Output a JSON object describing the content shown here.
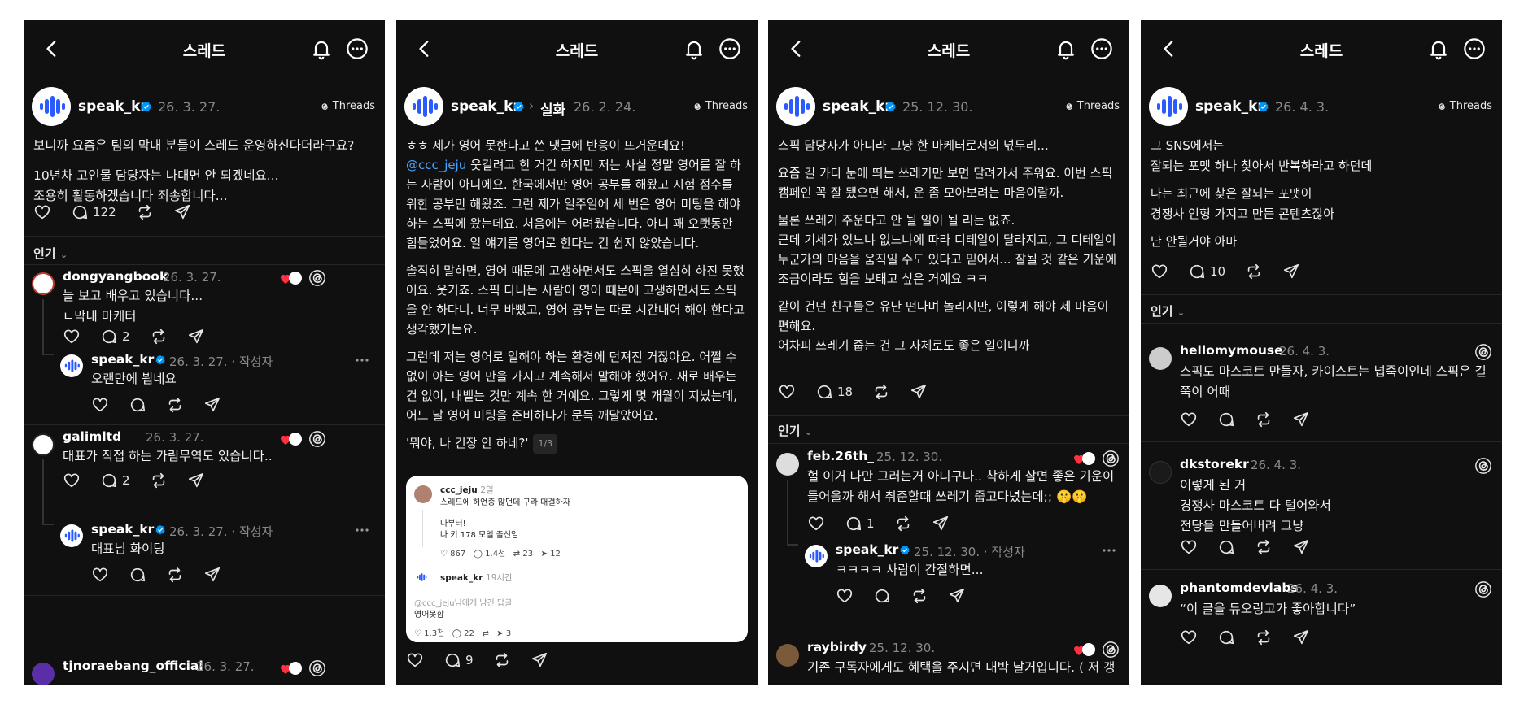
{
  "panels": [
    {
      "header_title": "스레드",
      "post": {
        "username": "speak_kr",
        "date": "26. 3. 27.",
        "badge": "Threads",
        "paragraphs": [
          "보니까 요즘은 팀의 막내 분들이 스레드 운영하신다더라구요?",
          "10년차 고인물 담당자는 나대면 안 되겠네요...",
          "조용히 활동하겠습니다 죄송합니다..."
        ],
        "reply_count": "122"
      },
      "sort_label": "인기",
      "comments": [
        {
          "username": "dongyangbook",
          "date": "26. 3. 27.",
          "text_lines": [
            "늘 보고 배우고 있습니다...",
            "ㄴ막내 마케터"
          ],
          "reply_count": "2"
        },
        {
          "username": "speak_kr",
          "date": "26. 3. 27. · 작성자",
          "text_lines": [
            "오랜만에 뵙네요"
          ],
          "reply_count": ""
        },
        {
          "username": "galimltd",
          "date": "26. 3. 27.",
          "text_lines": [
            "대표가 직접 하는 가림무역도 있습니다.."
          ],
          "reply_count": "2"
        },
        {
          "username": "speak_kr",
          "date": "26. 3. 27. · 작성자",
          "text_lines": [
            "대표님 화이팅"
          ],
          "reply_count": ""
        },
        {
          "username": "tjnoraebang_official",
          "date": "26. 3. 27.",
          "text_lines": [],
          "reply_count": ""
        }
      ]
    },
    {
      "header_title": "스레드",
      "post": {
        "username": "speak_kr",
        "topic": "실화",
        "date": "26. 2. 24.",
        "badge": "Threads",
        "mention": "@ccc_jeju",
        "paragraphs": [
          "ㅎㅎ 제가 영어 못한다고 쓴 댓글에 반응이 뜨거운데요!",
          "웃길려고 한 거긴 하지만 저는 사실 정말 영어를 잘 하는 사람이 아니에요. 한국에서만 영어 공부를 해왔고 시험 점수를 위한 공부만 해왔죠. 그런 제가 일주일에 세 번은 영어 미팅을 해야하는 스픽에 왔는데요. 처음에는 어려웠습니다. 아니 꽤 오랫동안 힘들었어요. 일 얘기를 영어로 한다는 건 쉽지 않았습니다.",
          "솔직히 말하면, 영어 때문에 고생하면서도 스픽을 열심히 하진 못했어요. 웃기죠. 스픽 다니는 사람이 영어 때문에 고생하면서도 스픽을 안 하다니. 너무 바빴고, 영어 공부는 따로 시간내어 해야 한다고 생각했거든요.",
          "그런데 저는 영어로 일해야 하는 환경에 던져진 거잖아요. 어쩔 수 없이 아는 영어 만을 가지고 계속해서 말해야 했어요. 새로 배우는 건 없이, 내뱉는 것만 계속 한 거예요. 그렇게 몇 개월이 지났는데, 어느 날 영어 미팅을 준비하다가 문득 깨달았어요.",
          "'뭐야, 나 긴장 안 하네?'"
        ],
        "pager": "1/3",
        "reply_count": "9",
        "embed": {
          "user": "ccc_jeju",
          "age": "2일",
          "line1": "스레드에 허언증 많던데 구라 대결하자",
          "line2": "나부터!",
          "line3": "나 키 178 모델 출신임",
          "likes": "867",
          "replies": "1.4천",
          "reposts": "23",
          "shares": "12",
          "reply_user": "speak_kr",
          "reply_age": "19시간",
          "reply_to": "@ccc_jeju님에게 남긴 답글",
          "reply_text": "영어못함",
          "r_likes": "1.3천",
          "r_replies": "22",
          "r_shares": "3"
        }
      }
    },
    {
      "header_title": "스레드",
      "post": {
        "username": "speak_kr",
        "date": "25. 12. 30.",
        "badge": "Threads",
        "paragraphs": [
          "스픽 담당자가 아니라 그냥 한 마케터로서의 넋두리...",
          "요즘 길 가다 눈에 띄는 쓰레기만 보면 달려가서 주워요. 이번 스픽 캠페인 꼭 잘 됐으면 해서, 운 좀 모아보려는 마음이랄까.",
          "물론 쓰레기 주운다고 안 될 일이 될 리는 없죠.",
          "근데 기세가 있느냐 없느냐에 따라 디테일이 달라지고, 그 디테일이 누군가의 마음을 움직일 수도 있다고 믿어서... 잘될 것 같은 기운에 조금이라도 힘을 보태고 싶은 거예요 ㅋㅋ",
          "같이 건던 친구들은 유난 떤다며 놀리지만, 이렇게 해야 제 마음이 편해요.",
          "어차피 쓰레기 줍는 건 그 자체로도 좋은 일이니까"
        ],
        "reply_count": "18"
      },
      "sort_label": "인기",
      "comments": [
        {
          "username": "feb.26th_",
          "date": "25. 12. 30.",
          "text_lines": [
            "헐 이거 나만 그러는거 아니구나.. 착하게 살면 좋은 기운이 들어올까 해서 취준할때 쓰레기 줍고다녔는데;; 🤫🤫"
          ],
          "reply_count": "1"
        },
        {
          "username": "speak_kr",
          "date": "25. 12. 30. · 작성자",
          "text_lines": [
            "ㅋㅋㅋㅋ 사람이 간절하면..."
          ],
          "reply_count": ""
        },
        {
          "username": "raybirdy",
          "date": "25. 12. 30.",
          "text_lines": [
            "기존 구독자에게도 혜택을 주시면 대박 날거입니다. ( 저 갱"
          ],
          "reply_count": ""
        }
      ]
    },
    {
      "header_title": "스레드",
      "post": {
        "username": "speak_kr",
        "date": "26. 4. 3.",
        "badge": "Threads",
        "paragraphs": [
          "그 SNS에서는",
          "잘되는 포맷 하나 찾아서 반복하라고 하던데",
          "나는 최근에 찾은 잘되는 포맷이",
          "경쟁사 인형 가지고 만든 콘텐츠잖아",
          "난 안될거야 아마"
        ],
        "reply_count": "10"
      },
      "sort_label": "인기",
      "comments": [
        {
          "username": "hellomymouse",
          "date": "26. 4. 3.",
          "text_lines": [
            "스픽도 마스코트 만들자, 카이스트는 넙죽이인데 스픽은 길쭉이 어때"
          ],
          "reply_count": ""
        },
        {
          "username": "dkstorekr",
          "date": "26. 4. 3.",
          "text_lines": [
            "이렇게 된 거",
            "경쟁사 마스코트 다 털어와서",
            "전당을 만들어버려 그냥"
          ],
          "reply_count": ""
        },
        {
          "username": "phantomdevlabs",
          "date": "26. 4. 3.",
          "text_lines": [
            "“이 글을 듀오링고가 좋아합니다”"
          ],
          "reply_count": ""
        }
      ]
    }
  ],
  "colors": {
    "bg": "#101010",
    "verified": "#0095f6",
    "like_red": "#ff3040",
    "muted": "#8a8a8a",
    "brand_blue": "#2b5bff"
  },
  "icons": [
    "back-icon",
    "bell-icon",
    "more-icon",
    "heart-icon",
    "comment-icon",
    "repost-icon",
    "share-icon",
    "threads-icon",
    "verified-icon"
  ]
}
